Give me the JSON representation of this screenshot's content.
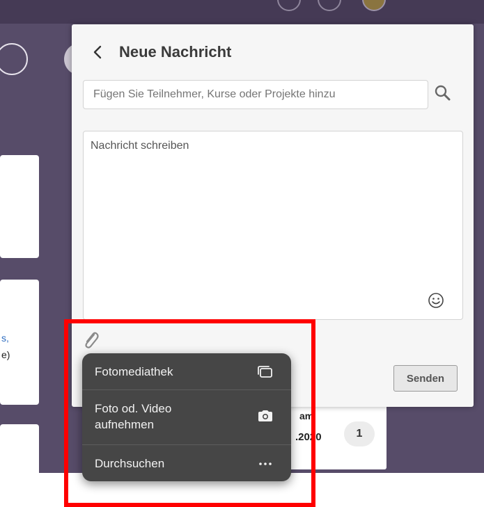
{
  "compose": {
    "title": "Neue Nachricht",
    "back_icon": "chevron-left-icon",
    "recipients_placeholder": "Fügen Sie Teilnehmer, Kurse oder Projekte hinzu",
    "message_placeholder": "Nachricht schreiben",
    "send_label": "Senden",
    "icons": [
      "search-icon",
      "emoji-icon",
      "paperclip-icon"
    ]
  },
  "attachment_menu": {
    "items": [
      {
        "label": "Fotomediathek",
        "icon": "photo-library-icon"
      },
      {
        "label": "Foto od. Video aufnehmen",
        "icon": "camera-icon"
      },
      {
        "label": "Durchsuchen",
        "icon": "more-dots-icon"
      }
    ]
  },
  "background": {
    "card_fragment_1": "s,",
    "card_fragment_2": "e)",
    "list_item": {
      "text": "am",
      "date": ".2020",
      "count": "1"
    }
  },
  "colors": {
    "background_purple": "#574c69",
    "panel": "#f6f6f6",
    "popover": "#464646",
    "highlight_box": "#ff0000"
  }
}
